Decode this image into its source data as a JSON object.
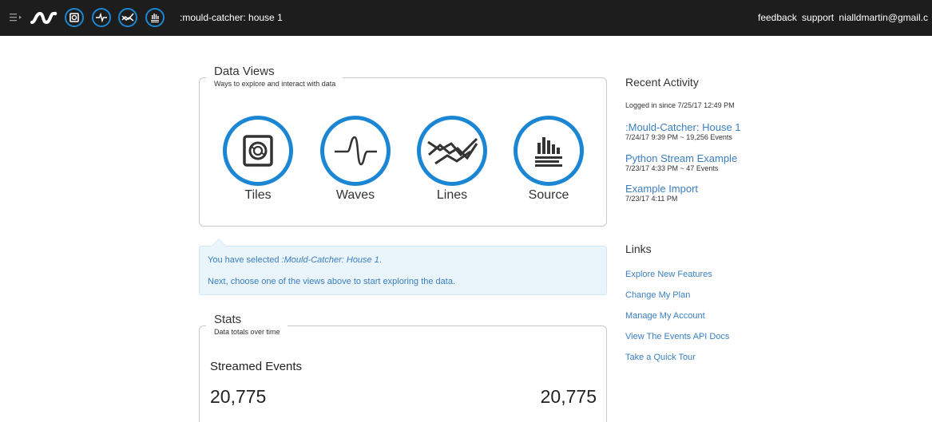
{
  "header": {
    "title": ":mould-catcher: house 1",
    "links": [
      "feedback",
      "support",
      "nialldmartin@gmail.c"
    ]
  },
  "colors": {
    "accent": "#1b86d3",
    "topbar": "#1d1d1d",
    "link": "#3a7fc1",
    "selected_bg": "#eaf4fb"
  },
  "data_views": {
    "title": "Data Views",
    "subtitle": "Ways to explore and interact with data",
    "views": [
      {
        "label": "Tiles",
        "icon": "tiles-icon"
      },
      {
        "label": "Waves",
        "icon": "waves-icon"
      },
      {
        "label": "Lines",
        "icon": "lines-icon"
      },
      {
        "label": "Source",
        "icon": "source-icon"
      }
    ]
  },
  "selection": {
    "prefix": "You have selected ",
    "name": ":Mould-Catcher: House 1",
    "suffix": ".",
    "instruction": "Next, choose one of the views above to start exploring the data."
  },
  "stats": {
    "title": "Stats",
    "subtitle": "Data totals over time",
    "heading": "Streamed Events",
    "left_value": "20,775",
    "right_value": "20,775"
  },
  "recent": {
    "title": "Recent Activity",
    "logged_in": "Logged in since 7/25/17 12:49 PM",
    "items": [
      {
        "title": ":Mould-Catcher: House 1",
        "meta": "7/24/17 9:39 PM ~ 19,256 Events"
      },
      {
        "title": "Python Stream Example",
        "meta": "7/23/17 4:33 PM ~ 47 Events"
      },
      {
        "title": "Example Import",
        "meta": "7/23/17 4:11 PM"
      }
    ]
  },
  "links": {
    "title": "Links",
    "items": [
      "Explore New Features",
      "Change My Plan",
      "Manage My Account",
      "View The Events API Docs",
      "Take a Quick Tour"
    ]
  }
}
